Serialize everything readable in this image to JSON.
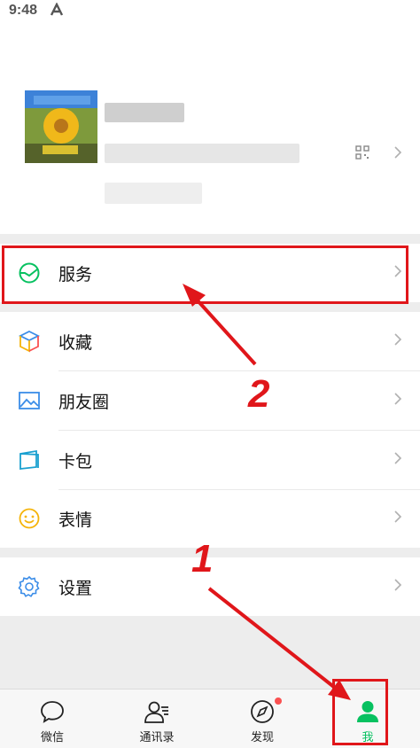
{
  "status_bar": {
    "time": "9:48"
  },
  "menu": {
    "service": "服务",
    "favorites": "收藏",
    "moments": "朋友圈",
    "cards": "卡包",
    "stickers": "表情",
    "settings": "设置"
  },
  "tabbar": {
    "chats": "微信",
    "contacts": "通讯录",
    "discover": "发现",
    "me": "我"
  },
  "annotations": {
    "step1": "1",
    "step2": "2"
  },
  "colors": {
    "accent": "#07c160",
    "annotation_red": "#e0161a",
    "discover_badge": "#fa5151"
  }
}
